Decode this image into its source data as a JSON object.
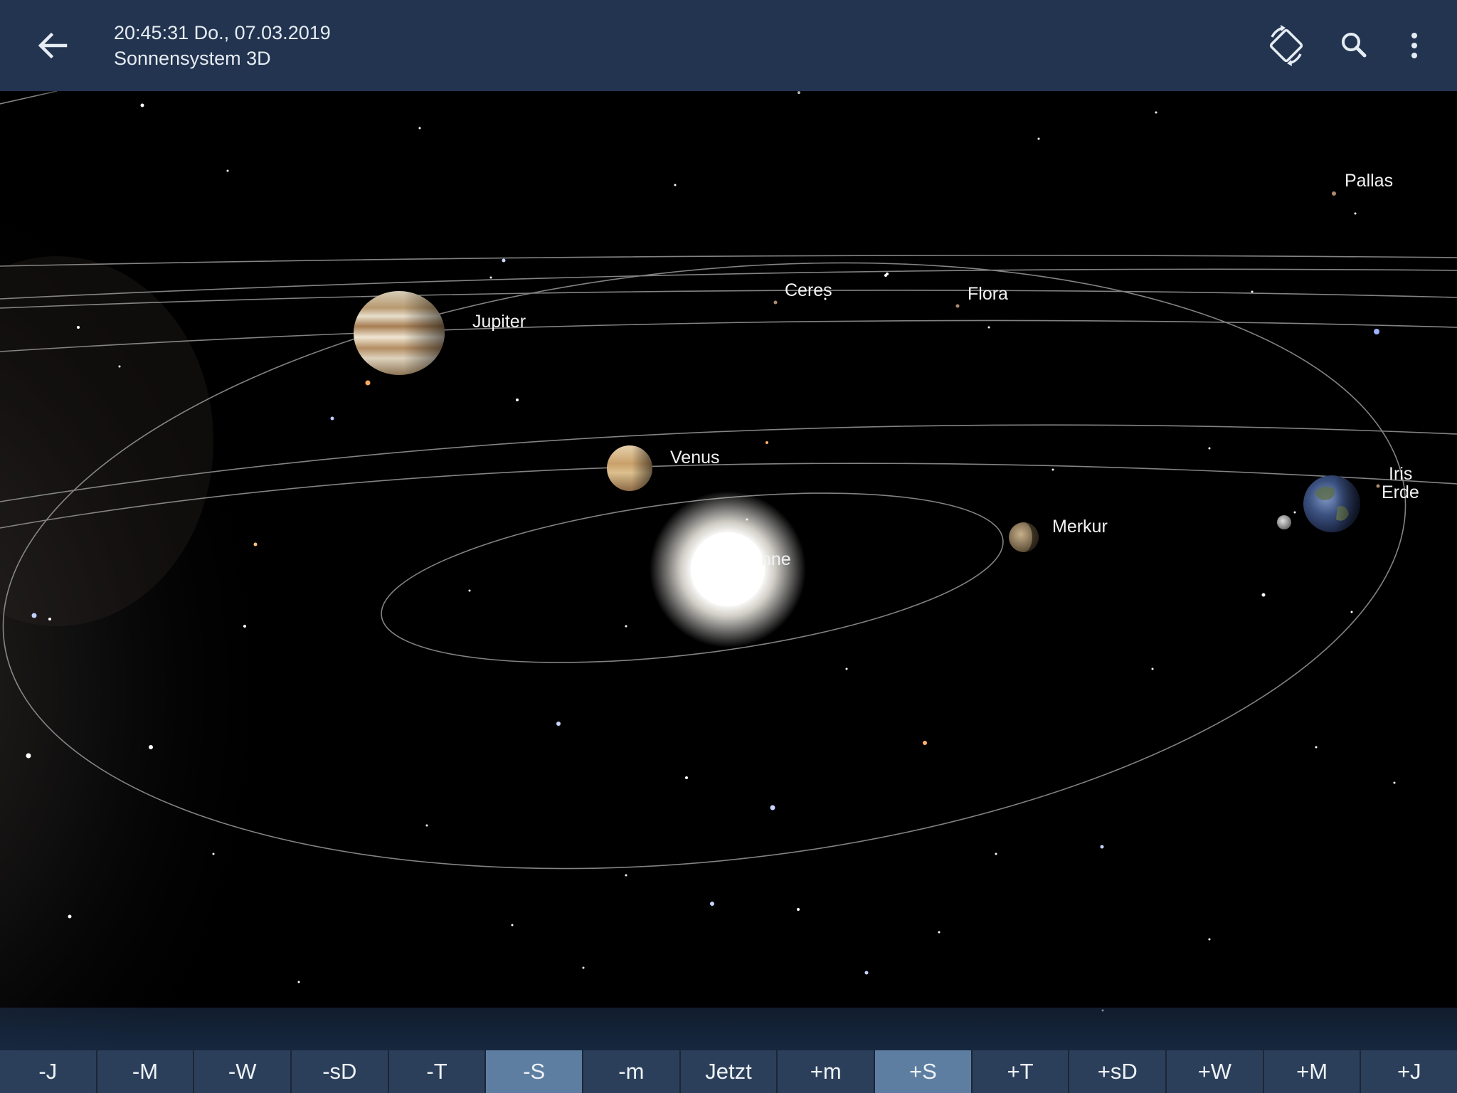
{
  "header": {
    "datetime": "20:45:31 Do., 07.03.2019",
    "title": "Sonnensystem 3D"
  },
  "bodies": {
    "pallas": "Pallas",
    "ceres": "Ceres",
    "flora": "Flora",
    "jupiter": "Jupiter",
    "venus": "Venus",
    "merkur": "Merkur",
    "iris": "Iris",
    "erde": "Erde",
    "sonne": "nne"
  },
  "time_buttons": [
    "-J",
    "-M",
    "-W",
    "-sD",
    "-T",
    "-S",
    "-m",
    "Jetzt",
    "+m",
    "+S",
    "+T",
    "+sD",
    "+W",
    "+M",
    "+J"
  ],
  "active_buttons": [
    "-S",
    "+S"
  ],
  "icons": {
    "back": "arrow-left-icon",
    "rotate": "screen-rotation-icon",
    "search": "search-icon",
    "menu": "more-vert-icon"
  }
}
